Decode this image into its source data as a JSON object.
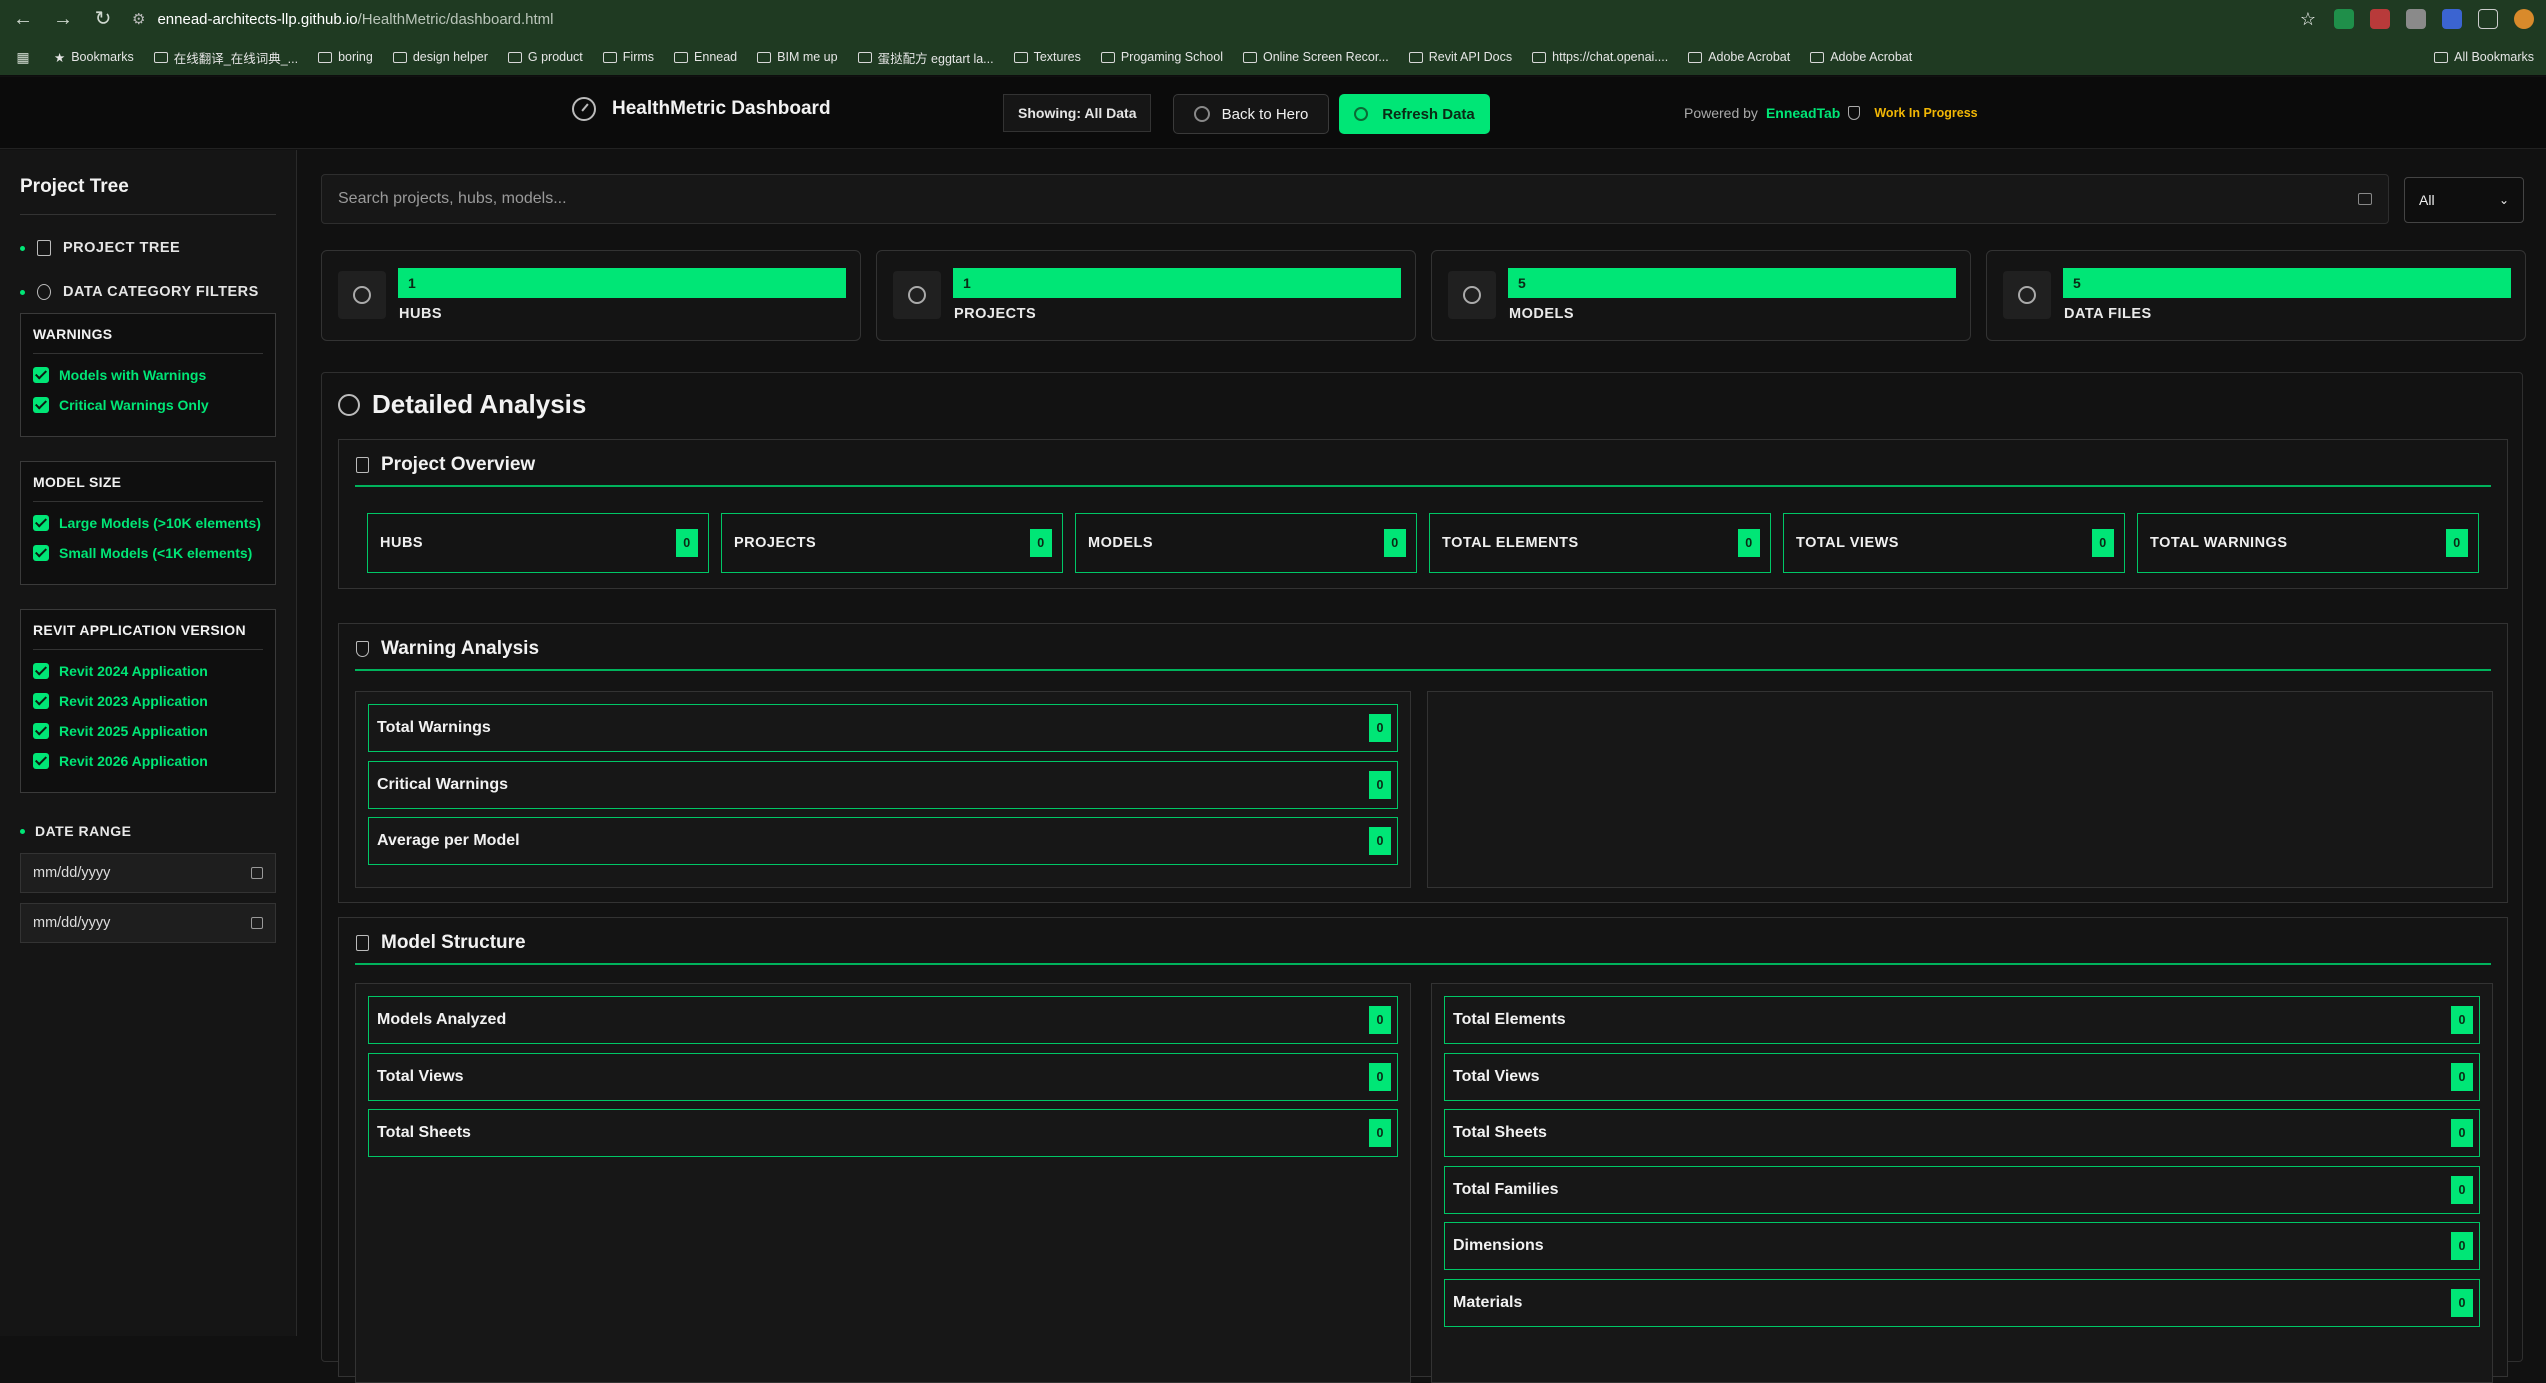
{
  "browser": {
    "url_host": "ennead-architects-llp.github.io",
    "url_path": "/HealthMetric/dashboard.html",
    "bookmarks": [
      "Bookmarks",
      "在线翻译_在线词典_...",
      "boring",
      "design helper",
      "G product",
      "Firms",
      "Ennead",
      "BIM me up",
      "蛋挞配方 eggtart la...",
      "Textures",
      "Progaming School",
      "Online Screen Recor...",
      "Revit API Docs",
      "https://chat.openai....",
      "Adobe Acrobat",
      "Adobe Acrobat"
    ],
    "all_bookmarks": "All Bookmarks"
  },
  "header": {
    "title": "HealthMetric Dashboard",
    "showing": "Showing: All Data",
    "back_label": "Back to Hero",
    "refresh_label": "Refresh Data",
    "powered_by": "Powered by",
    "powered_brand": "EnneadTab",
    "status": "Work In Progress"
  },
  "sidebar": {
    "title": "Project Tree",
    "nav_project_tree": "PROJECT TREE",
    "nav_filters": "DATA CATEGORY FILTERS",
    "groups": [
      {
        "title": "WARNINGS",
        "items": [
          "Models with Warnings",
          "Critical Warnings Only"
        ]
      },
      {
        "title": "MODEL SIZE",
        "items": [
          "Large Models (>10K elements)",
          "Small Models (<1K elements)"
        ]
      },
      {
        "title": "REVIT APPLICATION VERSION",
        "items": [
          "Revit 2024 Application",
          "Revit 2023 Application",
          "Revit 2025 Application",
          "Revit 2026 Application"
        ]
      }
    ],
    "date_range": "DATE RANGE",
    "date_placeholder_1": "mm/dd/yyyy",
    "date_placeholder_2": "mm/dd/yyyy"
  },
  "search": {
    "placeholder": "Search projects, hubs, models...",
    "filter_value": "All"
  },
  "stats": [
    {
      "value": "1",
      "label": "HUBS",
      "icon": "hub-icon"
    },
    {
      "value": "1",
      "label": "PROJECTS",
      "icon": "chart-icon"
    },
    {
      "value": "5",
      "label": "MODELS",
      "icon": "model-icon"
    },
    {
      "value": "5",
      "label": "DATA FILES",
      "icon": "gauge-icon"
    }
  ],
  "analysis": {
    "title": "Detailed Analysis",
    "overview_title": "Project Overview",
    "overview": [
      {
        "label": "HUBS",
        "value": "0"
      },
      {
        "label": "PROJECTS",
        "value": "0"
      },
      {
        "label": "MODELS",
        "value": "0"
      },
      {
        "label": "TOTAL ELEMENTS",
        "value": "0"
      },
      {
        "label": "TOTAL VIEWS",
        "value": "0"
      },
      {
        "label": "TOTAL WARNINGS",
        "value": "0"
      }
    ],
    "warning_title": "Warning Analysis",
    "warnings": [
      {
        "label": "Total Warnings",
        "value": "0"
      },
      {
        "label": "Critical Warnings",
        "value": "0"
      },
      {
        "label": "Average per Model",
        "value": "0"
      }
    ],
    "structure_title": "Model Structure",
    "structure_left": [
      {
        "label": "Models Analyzed",
        "value": "0"
      },
      {
        "label": "Total Views",
        "value": "0"
      },
      {
        "label": "Total Sheets",
        "value": "0"
      }
    ],
    "structure_right": [
      {
        "label": "Total Elements",
        "value": "0"
      },
      {
        "label": "Total Views",
        "value": "0"
      },
      {
        "label": "Total Sheets",
        "value": "0"
      },
      {
        "label": "Total Families",
        "value": "0"
      },
      {
        "label": "Dimensions",
        "value": "0"
      },
      {
        "label": "Materials",
        "value": "0"
      }
    ]
  },
  "colors": {
    "accent": "#00e676",
    "background": "#111111",
    "warning": "#f2b705"
  }
}
